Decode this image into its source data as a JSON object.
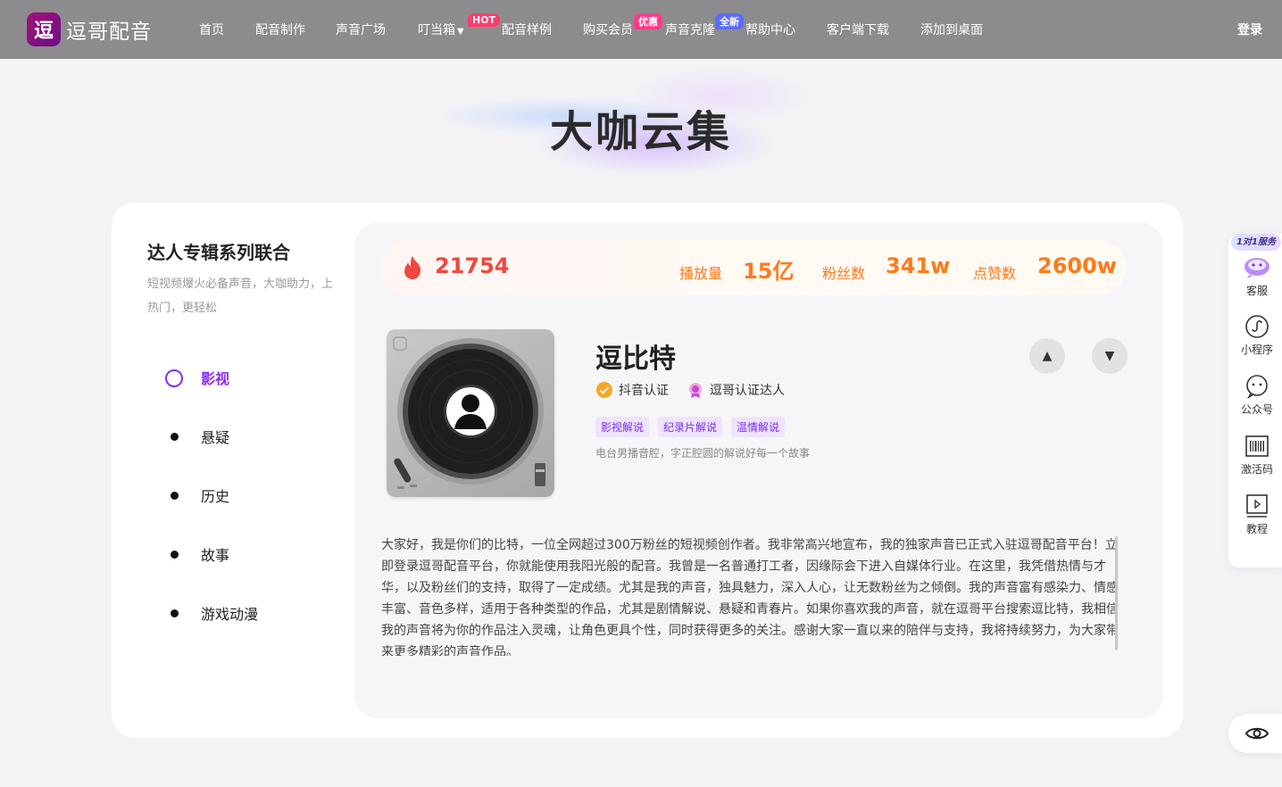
{
  "brand": {
    "name": "逗哥配音",
    "mark": "逗"
  },
  "nav": {
    "items": [
      {
        "label": "首页"
      },
      {
        "label": "配音制作"
      },
      {
        "label": "声音广场"
      },
      {
        "label": "叮当箱",
        "caret": "▼"
      },
      {
        "label": "配音样例",
        "badge": "HOT"
      },
      {
        "label": "购买会员"
      },
      {
        "label": "声音克隆",
        "badge": "优惠"
      },
      {
        "label": "帮助中心",
        "badge": "全新"
      },
      {
        "label": "客户端下载"
      },
      {
        "label": "添加到桌面"
      }
    ],
    "login": "登录"
  },
  "hero": {
    "title": "大咖云集"
  },
  "sidebar": {
    "title": "达人专辑系列联合",
    "desc": "短视频爆火必备声音，大咖助力，上热门，更轻松",
    "categories": [
      {
        "label": "影视",
        "active": true
      },
      {
        "label": "悬疑"
      },
      {
        "label": "历史"
      },
      {
        "label": "故事"
      },
      {
        "label": "游戏动漫"
      }
    ]
  },
  "stats": {
    "heat": "21754",
    "plays_label": "播放量",
    "plays": "15亿",
    "fans_label": "粉丝数",
    "fans": "341w",
    "likes_label": "点赞数",
    "likes": "2600w"
  },
  "artist": {
    "name": "逗比特",
    "certs": [
      "抖音认证",
      "逗哥认证达人"
    ],
    "tags": [
      "影视解说",
      "纪录片解说",
      "温情解说"
    ],
    "desc": "电台男播音腔，字正腔圆的解说好每一个故事",
    "bio": "大家好，我是你们的比特，一位全网超过300万粉丝的短视频创作者。我非常高兴地宣布，我的独家声音已正式入驻逗哥配音平台！立即登录逗哥配音平台，你就能使用我阳光般的配音。我曾是一名普通打工者，因缘际会下进入自媒体行业。在这里，我凭借热情与才华，以及粉丝们的支持，取得了一定成绩。尤其是我的声音，独具魅力，深入人心，让无数粉丝为之倾倒。我的声音富有感染力、情感丰富、音色多样，适用于各种类型的作品，尤其是剧情解说、悬疑和青春片。如果你喜欢我的声音，就在逗哥平台搜索逗比特，我相信我的声音将为你的作品注入灵魂，让角色更具个性，同时获得更多的关注。感谢大家一直以来的陪伴与支持，我将持续努力，为大家带来更多精彩的声音作品。"
  },
  "tools": {
    "service_badge": "1对1服务",
    "items": [
      {
        "label": "客服",
        "icon": "customer-service-icon"
      },
      {
        "label": "小程序",
        "icon": "mini-program-icon"
      },
      {
        "label": "公众号",
        "icon": "wechat-official-icon"
      },
      {
        "label": "激活码",
        "icon": "barcode-icon"
      },
      {
        "label": "教程",
        "icon": "tutorial-video-icon"
      }
    ]
  },
  "colors": {
    "accent": "#8b2cf5",
    "stat_orange": "#ff7a1a",
    "heat_red": "#f0483e",
    "header_bg": "#8c8c8e"
  }
}
